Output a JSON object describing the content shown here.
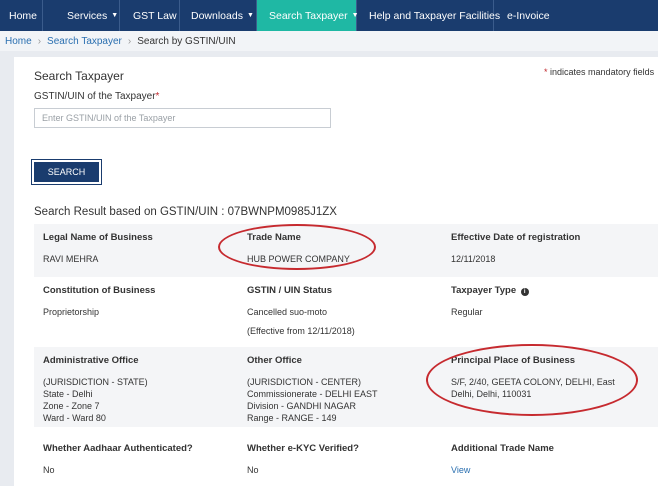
{
  "nav": {
    "items": [
      {
        "label": "Home",
        "caret": false
      },
      {
        "label": "Services",
        "caret": true
      },
      {
        "label": "GST Law",
        "caret": false
      },
      {
        "label": "Downloads",
        "caret": true
      },
      {
        "label": "Search Taxpayer",
        "caret": true,
        "active": true
      },
      {
        "label": "Help and Taxpayer Facilities",
        "caret": false
      },
      {
        "label": "e-Invoice",
        "caret": false
      }
    ]
  },
  "breadcrumb": {
    "home": "Home",
    "search_taxpayer": "Search Taxpayer",
    "current": "Search by GSTIN/UIN"
  },
  "form": {
    "heading": "Search Taxpayer",
    "mandatory_note": "indicates mandatory fields",
    "field_label": "GSTIN/UIN of the Taxpayer",
    "placeholder": "Enter GSTIN/UIN of the Taxpayer",
    "value": "",
    "search_button": "SEARCH"
  },
  "result": {
    "heading": "Search Result based on GSTIN/UIN : 07BWNPM0985J1ZX",
    "legal_name_label": "Legal Name of Business",
    "legal_name": "RAVI MEHRA",
    "trade_name_label": "Trade Name",
    "trade_name": "HUB POWER COMPANY",
    "effective_date_label": "Effective Date of registration",
    "effective_date": "12/11/2018",
    "constitution_label": "Constitution of Business",
    "constitution": "Proprietorship",
    "status_label": "GSTIN / UIN Status",
    "status": "Cancelled suo-moto",
    "status_effective": "(Effective from 12/11/2018)",
    "taxpayer_type_label": "Taxpayer Type",
    "taxpayer_type": "Regular",
    "admin_office_label": "Administrative Office",
    "admin_office": [
      "(JURISDICTION - STATE)",
      "State - Delhi",
      "Zone - Zone 7",
      "Ward - Ward 80"
    ],
    "other_office_label": "Other Office",
    "other_office": [
      "(JURISDICTION - CENTER)",
      "Commissionerate - DELHI EAST",
      "Division - GANDHI NAGAR",
      "Range - RANGE - 149"
    ],
    "principal_place_label": "Principal Place of Business",
    "principal_place": "S/F, 2/40, GEETA COLONY, DELHI, East Delhi, Delhi, 110031",
    "aadhaar_label": "Whether Aadhaar Authenticated?",
    "aadhaar": "No",
    "ekyc_label": "Whether e-KYC Verified?",
    "ekyc": "No",
    "additional_trade_label": "Additional Trade Name",
    "additional_trade": "View"
  },
  "colors": {
    "nav_bg": "#1a3c6e",
    "nav_active": "#1fb8a4",
    "highlight_circle": "#c62a2f",
    "link": "#2a6fb0"
  }
}
